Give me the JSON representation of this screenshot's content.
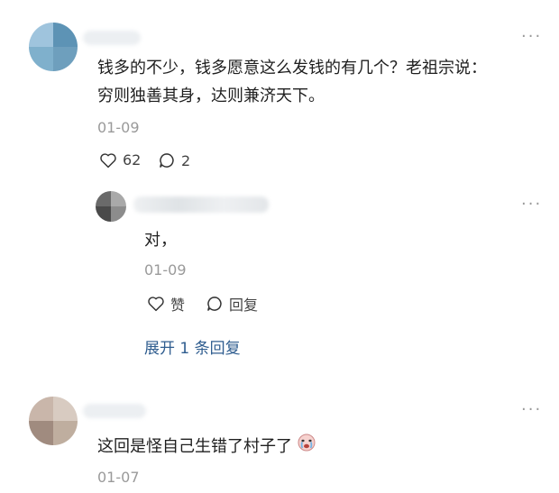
{
  "comments": [
    {
      "text_line1": "钱多的不少，钱多愿意这么发钱的有几个？老祖宗说：",
      "text_line2": "穷则独善其身，达则兼济天下。",
      "date": "01-09",
      "likes": "62",
      "replies": "2",
      "reply": {
        "text": "对，",
        "date": "01-09",
        "like_label": "赞",
        "reply_label": "回复",
        "expand_label": "展开 1 条回复"
      }
    },
    {
      "text": "这回是怪自己生错了村子了",
      "date": "01-07"
    }
  ],
  "icons": {
    "more": "more-icon",
    "like": "heart-icon",
    "comment": "comment-icon",
    "emoji": "crying-face-icon"
  }
}
